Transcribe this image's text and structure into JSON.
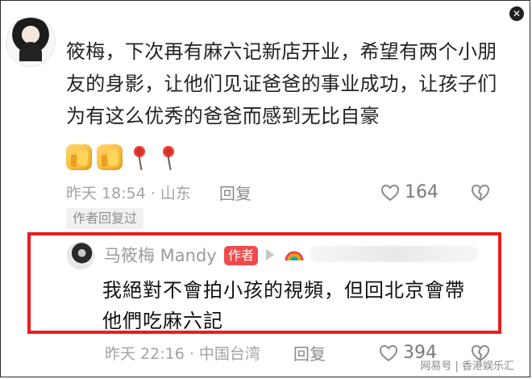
{
  "top_icon": "close-icon",
  "comment": {
    "text": "筱梅，下次再有麻六记新店开业，希望有两个小朋友的身影，让他们见证爸爸的事业成功，让孩子们为有这么优秀的爸爸而感到无比自豪",
    "meta": "昨天 18:54 · 山东",
    "reply_label": "回复",
    "likes": "164"
  },
  "author_replied_tag": "作者回复过",
  "reply": {
    "name": "马筱梅 Mandy",
    "badge": "作者",
    "text": "我絕對不會拍小孩的視頻，但回北京會帶他們吃麻六記",
    "meta": "昨天 22:16 · 中国台湾",
    "reply_label": "回复",
    "likes": "394"
  },
  "watermark": "网易号 | 香港娱乐汇",
  "colors": {
    "highlight": "#ea1d1d",
    "badge": "#f04b4b",
    "meta": "#a3a3a3"
  }
}
